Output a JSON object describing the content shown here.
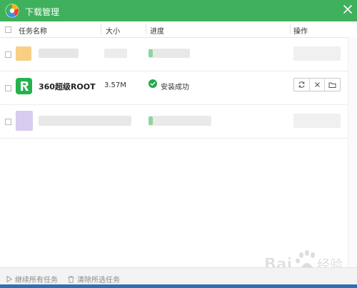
{
  "window": {
    "title": "下载管理",
    "close_label": "✕"
  },
  "table": {
    "headers": {
      "name": "任务名称",
      "size": "大小",
      "progress": "进度",
      "ops": "操作"
    },
    "rows": [
      {
        "name": "360超级ROOT",
        "size": "3.57M",
        "status": "安装成功",
        "icon": "360-root-app-icon",
        "ops": [
          "retry-icon",
          "delete-icon",
          "folder-icon"
        ]
      }
    ]
  },
  "footer": {
    "continue_all": "继续所有任务",
    "clear_selected": "清除所选任务"
  },
  "colors": {
    "titlebar": "#3fb15c",
    "accent_green": "#24b24e",
    "status_ok": "#22a84a"
  }
}
